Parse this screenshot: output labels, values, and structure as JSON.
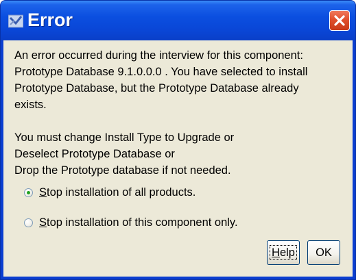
{
  "window": {
    "title": "Error",
    "title_icon": "java-app-icon",
    "close_icon": "close-icon"
  },
  "message": {
    "lines": [
      "An error occurred during the interview for this component:",
      "Prototype Database 9.1.0.0.0 . You have selected to install",
      "Prototype Database, but the Prototype Database already",
      "exists.",
      "",
      "You must change Install Type to Upgrade or",
      "Deselect Prototype Database or",
      "Drop the Prototype database if not needed."
    ]
  },
  "options": [
    {
      "mnemonic": "S",
      "label_rest": "top installation of all products.",
      "selected": true
    },
    {
      "mnemonic": "S",
      "label_rest": "top installation of this component only.",
      "selected": false
    }
  ],
  "buttons": {
    "help": {
      "mnemonic": "H",
      "label_rest": "elp"
    },
    "ok": {
      "label": "OK"
    }
  },
  "colors": {
    "titlebar": "#0a46d6",
    "client_background": "#ece9d8",
    "close_button": "#e0502c",
    "radio_dot": "#21a121"
  }
}
